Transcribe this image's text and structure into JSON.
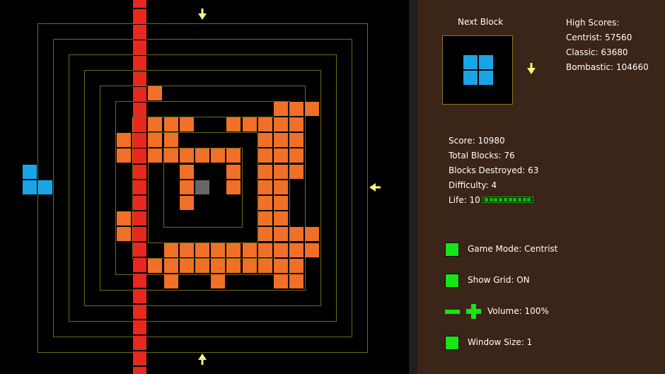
{
  "game": {
    "colors": {
      "background": "#000000",
      "grid": "#6e6a18",
      "laser": "#e8281e",
      "block": "#f07028",
      "core": "#666666",
      "piece": "#17a5e8",
      "arrow": "#fff37a"
    },
    "arrows": [
      {
        "name": "arrow-top",
        "direction": "down",
        "icon": "down-arrow-icon"
      },
      {
        "name": "arrow-right",
        "direction": "left",
        "icon": "left-arrow-icon"
      },
      {
        "name": "arrow-bottom",
        "direction": "up",
        "icon": "up-arrow-icon"
      }
    ]
  },
  "panel": {
    "next_block_label": "Next Block",
    "high_scores": {
      "title": "High Scores:",
      "centrist": "Centrist: 57560",
      "classic": "Classic: 63680",
      "bombastic": "Bombastic: 104660"
    },
    "stats": {
      "score": "Score: 10980",
      "total_blocks": "Total Blocks: 76",
      "blocks_destroyed": "Blocks Destroyed: 63",
      "difficulty": "Difficulty: 4",
      "life": "Life: 10",
      "life_value": 10,
      "life_max": 10
    },
    "controls": {
      "game_mode": "Game Mode: Centrist",
      "show_grid": "Show Grid: ON",
      "volume": "Volume: 100%",
      "window_size": "Window Size: 1"
    }
  }
}
